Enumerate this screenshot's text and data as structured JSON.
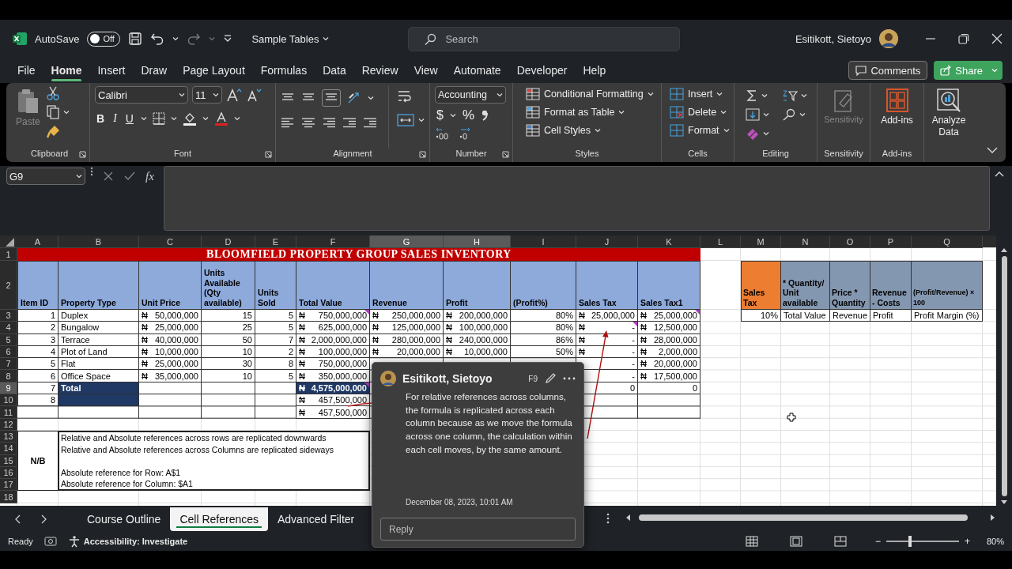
{
  "title_bar": {
    "autosave": {
      "label": "AutoSave",
      "on": false,
      "state_text": "Off"
    },
    "document": "Sample Tables",
    "search": {
      "placeholder": "Search"
    },
    "user": "Esitikott, Sietoyo"
  },
  "menu": {
    "tabs": [
      {
        "label": "File",
        "selected": false
      },
      {
        "label": "Home",
        "selected": true
      },
      {
        "label": "Insert",
        "selected": false
      },
      {
        "label": "Draw",
        "selected": false
      },
      {
        "label": "Page Layout",
        "selected": false
      },
      {
        "label": "Formulas",
        "selected": false
      },
      {
        "label": "Data",
        "selected": false
      },
      {
        "label": "Review",
        "selected": false
      },
      {
        "label": "View",
        "selected": false
      },
      {
        "label": "Automate",
        "selected": false
      },
      {
        "label": "Developer",
        "selected": false
      },
      {
        "label": "Help",
        "selected": false
      }
    ],
    "comments": "Comments",
    "share": "Share"
  },
  "ribbon": {
    "clipboard": {
      "paste": "Paste",
      "label": "Clipboard"
    },
    "font": {
      "name": "Calibri",
      "size": "11",
      "bold": "B",
      "italic": "I",
      "underline": "U",
      "label": "Font"
    },
    "alignment": {
      "label": "Alignment"
    },
    "number": {
      "format": "Accounting",
      "currency": "$",
      "percent": "%",
      "label": "Number"
    },
    "styles": {
      "items": [
        "Conditional Formatting",
        "Format as Table",
        "Cell Styles"
      ],
      "label": "Styles"
    },
    "cells": {
      "items": [
        "Insert",
        "Delete",
        "Format"
      ],
      "label": "Cells"
    },
    "editing": {
      "label": "Editing"
    },
    "sensitivity": {
      "button": "Sensitivity",
      "label": "Sensitivity",
      "disabled": true
    },
    "addins": {
      "button": "Add-ins",
      "label": "Add-ins"
    },
    "analyze": {
      "button": "Analyze Data"
    }
  },
  "formula_bar": {
    "name_box": "G9",
    "function_label": "fx"
  },
  "sheet": {
    "columns": [
      {
        "letter": "A",
        "highlighted": false
      },
      {
        "letter": "B",
        "highlighted": false
      },
      {
        "letter": "C",
        "highlighted": false
      },
      {
        "letter": "D",
        "highlighted": false
      },
      {
        "letter": "E",
        "highlighted": false
      },
      {
        "letter": "F",
        "highlighted": false
      },
      {
        "letter": "G",
        "highlighted": true
      },
      {
        "letter": "H",
        "highlighted": true
      },
      {
        "letter": "I",
        "highlighted": false
      },
      {
        "letter": "J",
        "highlighted": false
      },
      {
        "letter": "K",
        "highlighted": false
      },
      {
        "letter": "L",
        "highlighted": false
      },
      {
        "letter": "M",
        "highlighted": false
      },
      {
        "letter": "N",
        "highlighted": false
      },
      {
        "letter": "O",
        "highlighted": false
      },
      {
        "letter": "P",
        "highlighted": false
      },
      {
        "letter": "Q",
        "highlighted": false
      }
    ],
    "rows": [
      {
        "number": "1",
        "highlighted": false
      },
      {
        "number": "2",
        "highlighted": false
      },
      {
        "number": "3",
        "highlighted": false
      },
      {
        "number": "4",
        "highlighted": false
      },
      {
        "number": "5",
        "highlighted": false
      },
      {
        "number": "6",
        "highlighted": false
      },
      {
        "number": "7",
        "highlighted": false
      },
      {
        "number": "8",
        "highlighted": false
      },
      {
        "number": "9",
        "highlighted": true
      },
      {
        "number": "10",
        "highlighted": false
      },
      {
        "number": "11",
        "highlighted": false
      },
      {
        "number": "12",
        "highlighted": false
      },
      {
        "number": "13",
        "highlighted": false
      },
      {
        "number": "14",
        "highlighted": false
      },
      {
        "number": "15",
        "highlighted": false
      },
      {
        "number": "16",
        "highlighted": false
      },
      {
        "number": "17",
        "highlighted": false
      },
      {
        "number": "18",
        "highlighted": false
      }
    ],
    "title": "BLOOMFIELD PROPERTY GROUP SALES INVENTORY",
    "headers": [
      "Item ID",
      "Property Type",
      "Unit Price",
      "Units Available (Qty available)",
      "Units Sold",
      "Total Value",
      "Revenue",
      "Profit",
      "(Profit%)",
      "Sales Tax",
      "Sales Tax1"
    ],
    "data": [
      {
        "A": {
          "kind": "num",
          "value": "1"
        },
        "B": {
          "kind": "text",
          "value": "Duplex"
        },
        "C": {
          "kind": "money",
          "currency": "₦",
          "value": "50,000,000"
        },
        "D": {
          "kind": "num",
          "value": "15"
        },
        "E": {
          "kind": "num",
          "value": "5"
        },
        "F": {
          "kind": "money",
          "currency": "₦",
          "value": "750,000,000",
          "comment": true
        },
        "G": {
          "kind": "money",
          "currency": "₦",
          "value": "250,000,000"
        },
        "H": {
          "kind": "money",
          "currency": "₦",
          "value": "200,000,000"
        },
        "I": {
          "kind": "num",
          "value": "80%"
        },
        "J": {
          "kind": "money",
          "currency": "₦",
          "value": "25,000,000"
        },
        "K": {
          "kind": "money",
          "currency": "₦",
          "value": "25,000,000",
          "comment": true
        }
      },
      {
        "A": {
          "kind": "num",
          "value": "2"
        },
        "B": {
          "kind": "text",
          "value": "Bungalow"
        },
        "C": {
          "kind": "money",
          "currency": "₦",
          "value": "25,000,000"
        },
        "D": {
          "kind": "num",
          "value": "25"
        },
        "E": {
          "kind": "num",
          "value": "5"
        },
        "F": {
          "kind": "money",
          "currency": "₦",
          "value": "625,000,000"
        },
        "G": {
          "kind": "money",
          "currency": "₦",
          "value": "125,000,000"
        },
        "H": {
          "kind": "money",
          "currency": "₦",
          "value": "100,000,000"
        },
        "I": {
          "kind": "num",
          "value": "80%"
        },
        "J": {
          "kind": "money",
          "currency": "₦",
          "value": "-",
          "comment": true
        },
        "K": {
          "kind": "money",
          "currency": "₦",
          "value": "12,500,000"
        }
      },
      {
        "A": {
          "kind": "num",
          "value": "3"
        },
        "B": {
          "kind": "text",
          "value": "Terrace"
        },
        "C": {
          "kind": "money",
          "currency": "₦",
          "value": "40,000,000"
        },
        "D": {
          "kind": "num",
          "value": "50"
        },
        "E": {
          "kind": "num",
          "value": "7"
        },
        "F": {
          "kind": "money",
          "currency": "₦",
          "value": "2,000,000,000"
        },
        "G": {
          "kind": "money",
          "currency": "₦",
          "value": "280,000,000"
        },
        "H": {
          "kind": "money",
          "currency": "₦",
          "value": "240,000,000"
        },
        "I": {
          "kind": "num",
          "value": "86%"
        },
        "J": {
          "kind": "money",
          "currency": "₦",
          "value": "-"
        },
        "K": {
          "kind": "money",
          "currency": "₦",
          "value": "28,000,000"
        }
      },
      {
        "A": {
          "kind": "num",
          "value": "4"
        },
        "B": {
          "kind": "text",
          "value": "Plot of Land"
        },
        "C": {
          "kind": "money",
          "currency": "₦",
          "value": "10,000,000"
        },
        "D": {
          "kind": "num",
          "value": "10"
        },
        "E": {
          "kind": "num",
          "value": "2"
        },
        "F": {
          "kind": "money",
          "currency": "₦",
          "value": "100,000,000"
        },
        "G": {
          "kind": "money",
          "currency": "₦",
          "value": "20,000,000"
        },
        "H": {
          "kind": "money",
          "currency": "₦",
          "value": "10,000,000"
        },
        "I": {
          "kind": "num",
          "value": "50%"
        },
        "J": {
          "kind": "money",
          "currency": "₦",
          "value": "-"
        },
        "K": {
          "kind": "money",
          "currency": "₦",
          "value": "2,000,000"
        }
      },
      {
        "A": {
          "kind": "num",
          "value": "5"
        },
        "B": {
          "kind": "text",
          "value": "Flat"
        },
        "C": {
          "kind": "money",
          "currency": "₦",
          "value": "25,000,000"
        },
        "D": {
          "kind": "num",
          "value": "30"
        },
        "E": {
          "kind": "num",
          "value": "8"
        },
        "F": {
          "kind": "money",
          "currency": "₦",
          "value": "750,000,000"
        },
        "J": {
          "kind": "money",
          "value": "-"
        },
        "K": {
          "kind": "money",
          "currency": "₦",
          "value": "20,000,000"
        }
      },
      {
        "A": {
          "kind": "num",
          "value": "6"
        },
        "B": {
          "kind": "text",
          "value": "Office Space"
        },
        "C": {
          "kind": "money",
          "currency": "₦",
          "value": "35,000,000"
        },
        "D": {
          "kind": "num",
          "value": "10"
        },
        "E": {
          "kind": "num",
          "value": "5"
        },
        "F": {
          "kind": "money",
          "currency": "₦",
          "value": "350,000,000"
        },
        "J": {
          "kind": "money",
          "value": "-"
        },
        "K": {
          "kind": "money",
          "currency": "₦",
          "value": "17,500,000"
        }
      },
      {
        "A": {
          "kind": "num",
          "value": "7"
        },
        "B": {
          "kind": "text",
          "value": "Total",
          "dark": true
        },
        "F": {
          "kind": "money",
          "currency": "₦",
          "value": "4,575,000,000",
          "dark": true,
          "comment": true
        },
        "J": {
          "kind": "num",
          "value": "0"
        },
        "K": {
          "kind": "num",
          "value": "0"
        }
      },
      {
        "A": {
          "kind": "num",
          "value": "8"
        },
        "B": {
          "kind": "text",
          "dark": true
        },
        "F": {
          "kind": "money",
          "currency": "₦",
          "value": "457,500,000"
        }
      },
      {
        "F": {
          "kind": "money",
          "currency": "₦",
          "value": "457,500,000"
        }
      }
    ],
    "notes": {
      "label": "N/B",
      "lines": [
        "Relative and Absolute references across rows are replicated downwards",
        "Relative and Absolute references across Columns are replicated sideways",
        "Absolute reference for Row: A$1",
        "Absolute reference for Column: $A1"
      ]
    },
    "side_headers": [
      {
        "text": "Sales Tax",
        "color": "#ed7d31"
      },
      {
        "text": "* Quantity/ Unit available",
        "color": "#8497b0"
      },
      {
        "text": "Price * Quantity",
        "color": "#8497b0"
      },
      {
        "text": "Revenue - Costs",
        "color": "#8497b0"
      },
      {
        "text": "(Profit/Revenue) × 100",
        "color": "#8497b0"
      }
    ],
    "side_values": [
      {
        "kind": "num",
        "value": "10%"
      },
      {
        "kind": "text",
        "value": "Total Value"
      },
      {
        "kind": "text",
        "value": "Revenue"
      },
      {
        "kind": "text",
        "value": "Profit"
      },
      {
        "kind": "text",
        "value": "Profit Margin (%)"
      }
    ]
  },
  "comment": {
    "author": "Esitikott, Sietoyo",
    "cell": "F9",
    "text": "For relative references across columns, the formula is replicated across each column because as we move the formula across one column, the calculation within each cell moves, by the same amount.",
    "date": "December 08, 2023, 10:01 AM",
    "reply_placeholder": "Reply"
  },
  "sheet_tabs": [
    {
      "label": "Course Outline",
      "selected": false
    },
    {
      "label": "Cell References",
      "selected": true
    },
    {
      "label": "Advanced Filter",
      "selected": false
    }
  ],
  "status_bar": {
    "mode": "Ready",
    "accessibility": "Accessibility: Investigate",
    "zoom": {
      "level": 0.33,
      "minus": "−",
      "plus": "+",
      "reading": "80%"
    }
  }
}
